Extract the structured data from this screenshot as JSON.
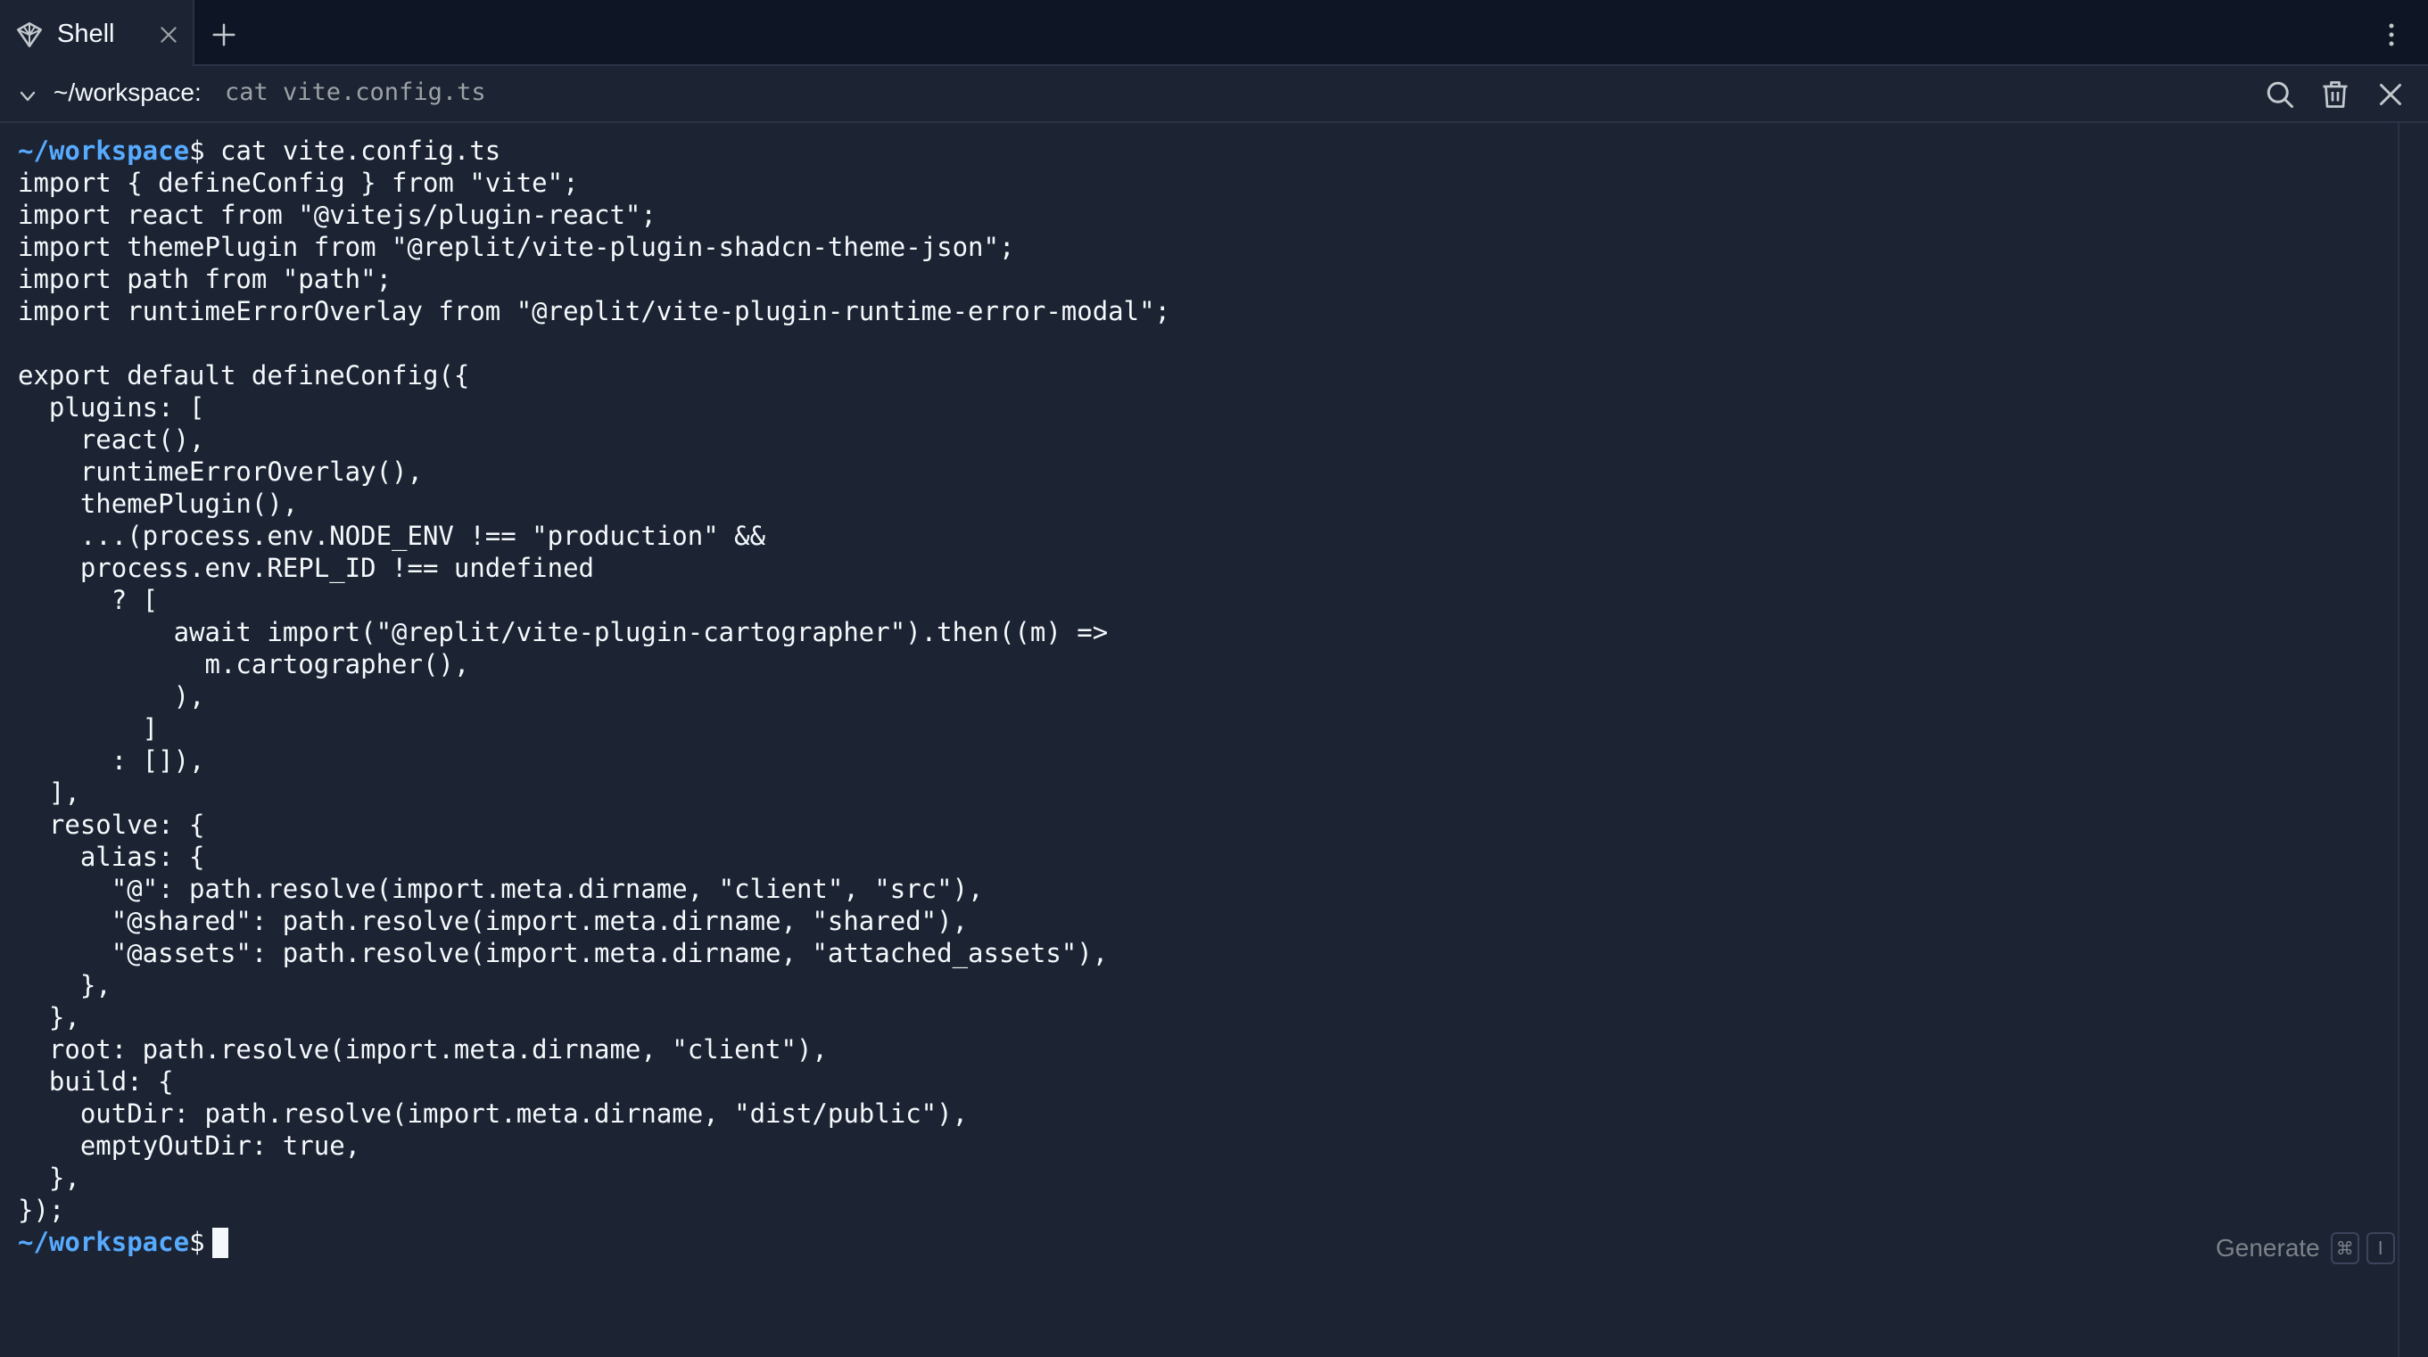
{
  "tab": {
    "title": "Shell",
    "icon": "shell-icon"
  },
  "command_bar": {
    "cwd": "~/workspace:",
    "command": "cat vite.config.ts"
  },
  "terminal": {
    "prompt": "~/workspace",
    "command_line": "$ cat vite.config.ts",
    "output": "import { defineConfig } from \"vite\";\nimport react from \"@vitejs/plugin-react\";\nimport themePlugin from \"@replit/vite-plugin-shadcn-theme-json\";\nimport path from \"path\";\nimport runtimeErrorOverlay from \"@replit/vite-plugin-runtime-error-modal\";\n\nexport default defineConfig({\n  plugins: [\n    react(),\n    runtimeErrorOverlay(),\n    themePlugin(),\n    ...(process.env.NODE_ENV !== \"production\" &&\n    process.env.REPL_ID !== undefined\n      ? [\n          await import(\"@replit/vite-plugin-cartographer\").then((m) =>\n            m.cartographer(),\n          ),\n        ]\n      : []),\n  ],\n  resolve: {\n    alias: {\n      \"@\": path.resolve(import.meta.dirname, \"client\", \"src\"),\n      \"@shared\": path.resolve(import.meta.dirname, \"shared\"),\n      \"@assets\": path.resolve(import.meta.dirname, \"attached_assets\"),\n    },\n  },\n  root: path.resolve(import.meta.dirname, \"client\"),\n  build: {\n    outDir: path.resolve(import.meta.dirname, \"dist/public\"),\n    emptyOutDir: true,\n  },\n});",
    "final_prompt_suffix": "$"
  },
  "generate": {
    "label": "Generate",
    "shortcut_key1": "⌘",
    "shortcut_key2": "I"
  },
  "colors": {
    "background": "#1c2333",
    "tabbar": "#0e1525",
    "prompt": "#57abff",
    "muted": "#9da2a6"
  }
}
